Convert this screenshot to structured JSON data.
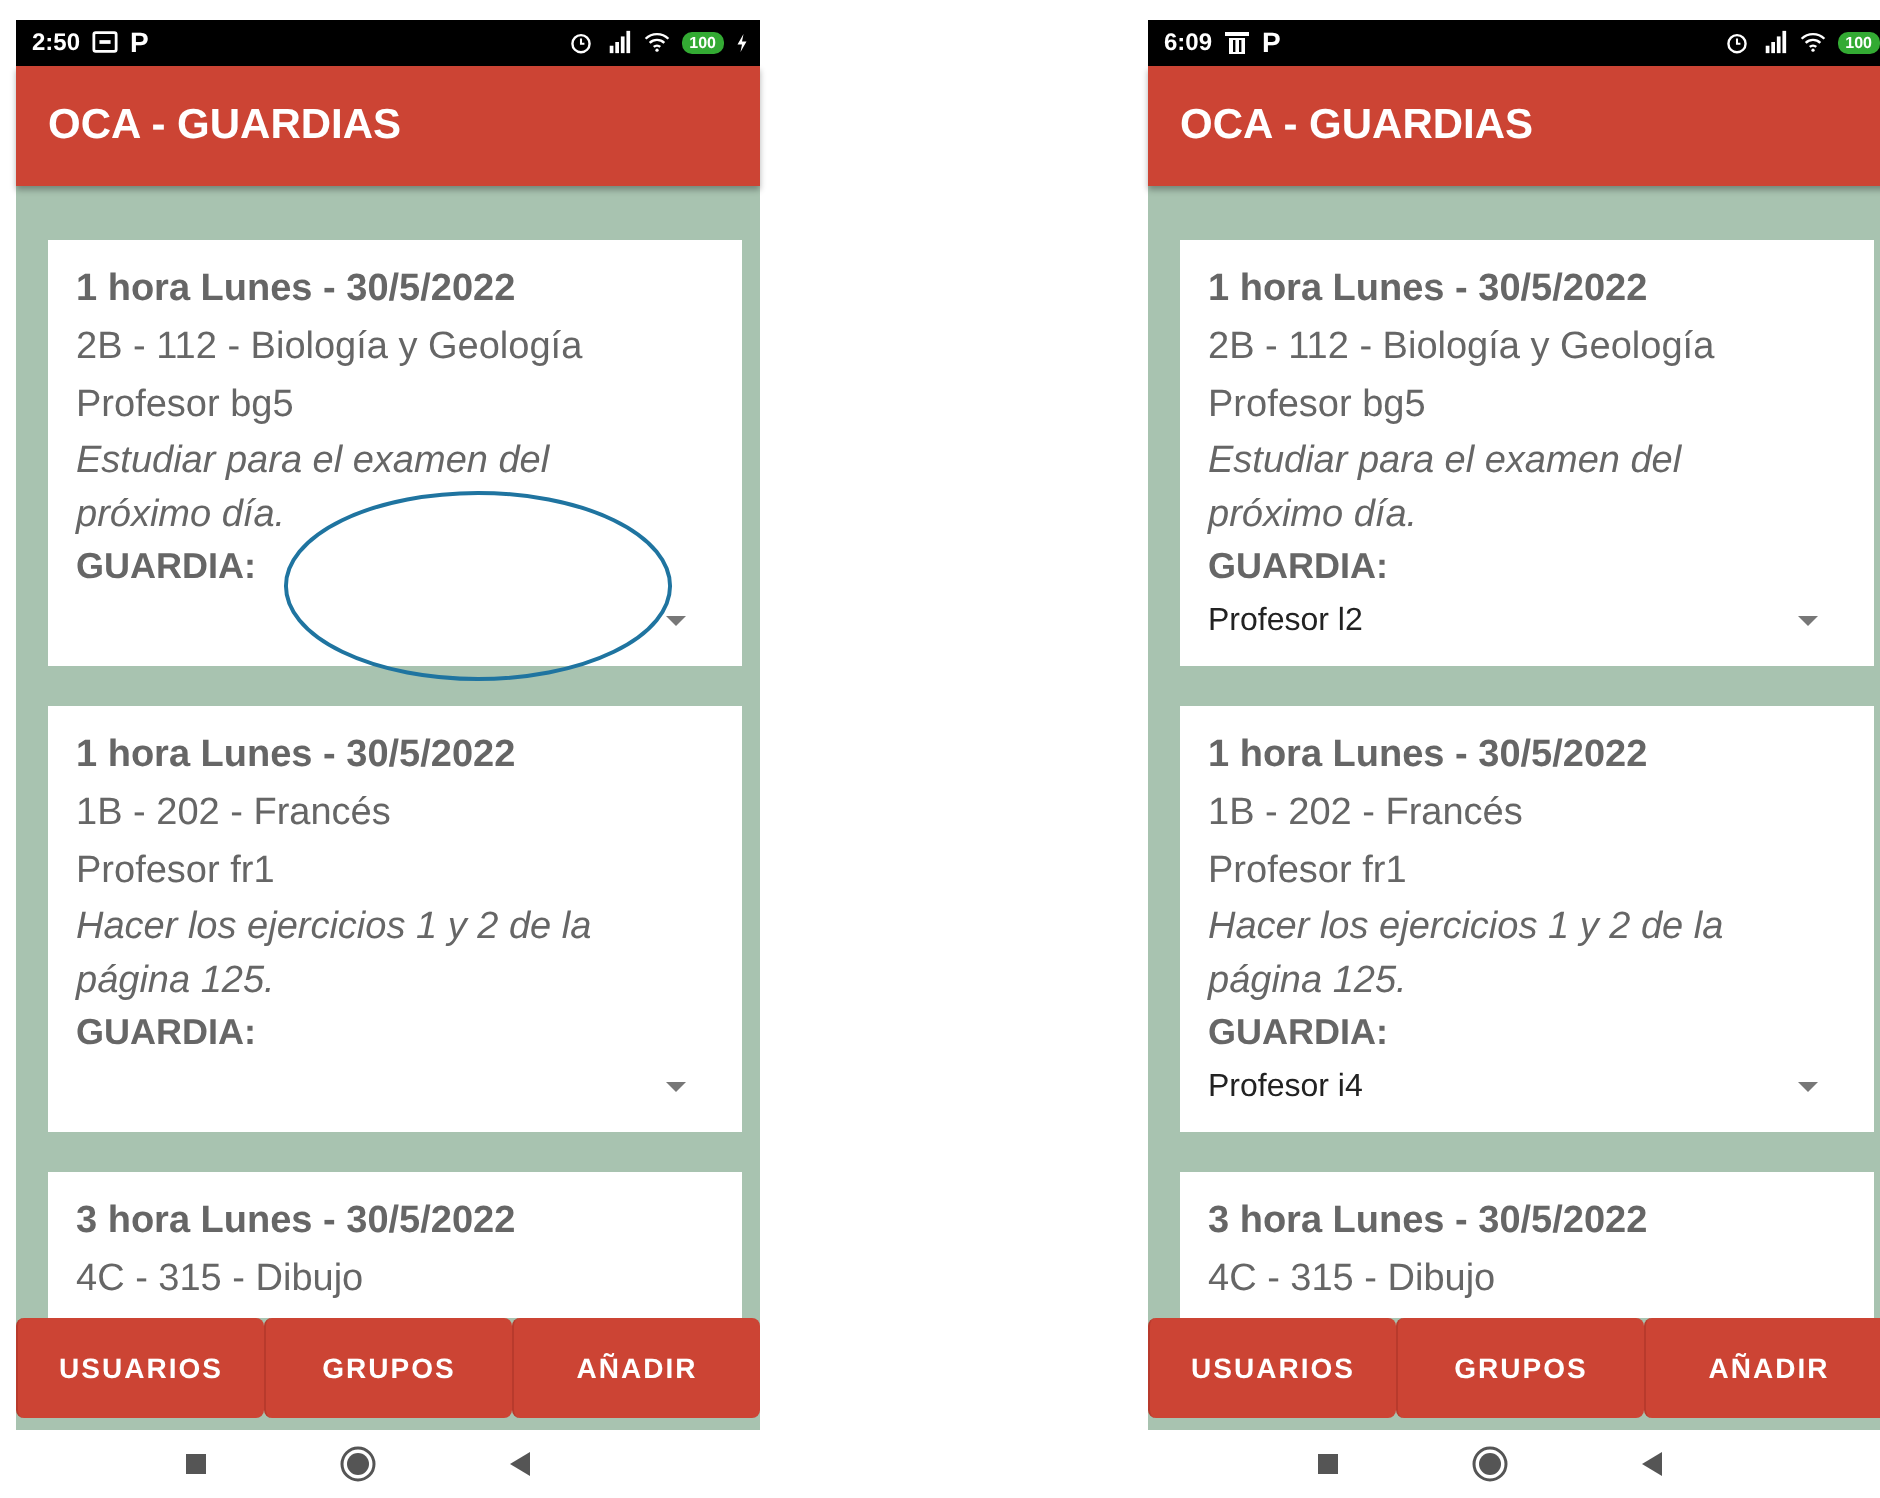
{
  "phones": [
    {
      "status_bar": {
        "time": "2:50",
        "notification": {
          "kind": "screen"
        },
        "p_label": "P",
        "battery": "100",
        "charging": true
      },
      "app_bar": {
        "title": "OCA - GUARDIAS"
      },
      "cards": [
        {
          "heading": "1 hora Lunes - 30/5/2022",
          "group": "2B - 112 - Biología y Geología",
          "teacher": "Profesor bg5",
          "note": "Estudiar para el examen del próximo día.",
          "guard_label": "GUARDIA:",
          "circled": true
        },
        {
          "heading": "1 hora Lunes - 30/5/2022",
          "group": "1B - 202 - Francés",
          "teacher": "Profesor fr1",
          "note": "Hacer los ejercicios 1 y 2 de la página 125.",
          "guard_label": "GUARDIA:",
          "circled": false
        },
        {
          "heading": "3 hora Lunes - 30/5/2022",
          "group": "4C - 315 - Dibujo"
        }
      ],
      "bottom_nav": [
        "USUARIOS",
        "GRUPOS",
        "AÑADIR"
      ]
    },
    {
      "status_bar": {
        "time": "6:09",
        "notification": {
          "kind": "trash"
        },
        "p_label": "P",
        "battery": "100",
        "charging": false
      },
      "app_bar": {
        "title": "OCA - GUARDIAS"
      },
      "cards": [
        {
          "heading": "1 hora Lunes - 30/5/2022",
          "group": "2B - 112 - Biología y Geología",
          "teacher": "Profesor bg5",
          "note": "Estudiar para el examen del próximo día.",
          "guard_label": "GUARDIA:",
          "guard_value": "Profesor l2",
          "circled": false
        },
        {
          "heading": "1 hora Lunes - 30/5/2022",
          "group": "1B - 202 - Francés",
          "teacher": "Profesor fr1",
          "note": "Hacer los ejercicios 1 y 2 de la página 125.",
          "guard_label": "GUARDIA:",
          "guard_value": "Profesor i4",
          "circled": false
        },
        {
          "heading": "3 hora Lunes - 30/5/2022",
          "group": "4C - 315 - Dibujo"
        }
      ],
      "bottom_nav": [
        "USUARIOS",
        "GRUPOS",
        "AÑADIR"
      ]
    }
  ]
}
